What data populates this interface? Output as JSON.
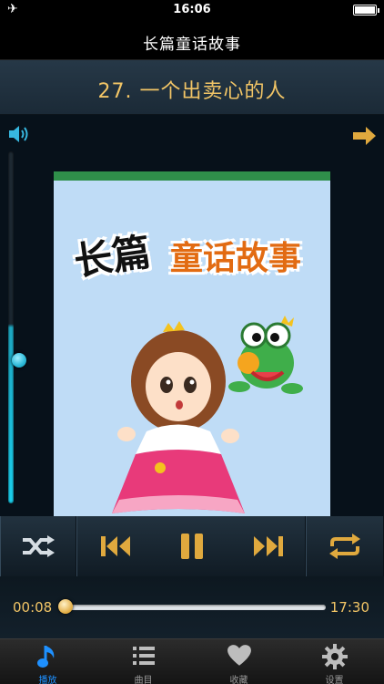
{
  "status_bar": {
    "time": "16:06",
    "battery_level": 0.9
  },
  "nav": {
    "title": "长篇童话故事"
  },
  "track": {
    "title": "27. 一个出卖心的人"
  },
  "cover": {
    "title_line1": "长篇",
    "title_line2": "童话故事"
  },
  "volume": {
    "level": 0.5
  },
  "progress": {
    "elapsed": "00:08",
    "total": "17:30",
    "fraction": 0.008
  },
  "tabs": [
    {
      "label": "播放",
      "icon": "music-note-icon",
      "active": true
    },
    {
      "label": "曲目",
      "icon": "list-icon",
      "active": false
    },
    {
      "label": "收藏",
      "icon": "heart-icon",
      "active": false
    },
    {
      "label": "设置",
      "icon": "gear-icon",
      "active": false
    }
  ],
  "colors": {
    "accent": "#f2c566",
    "tab_active": "#1e90ff",
    "volume": "#1ad0ee"
  }
}
